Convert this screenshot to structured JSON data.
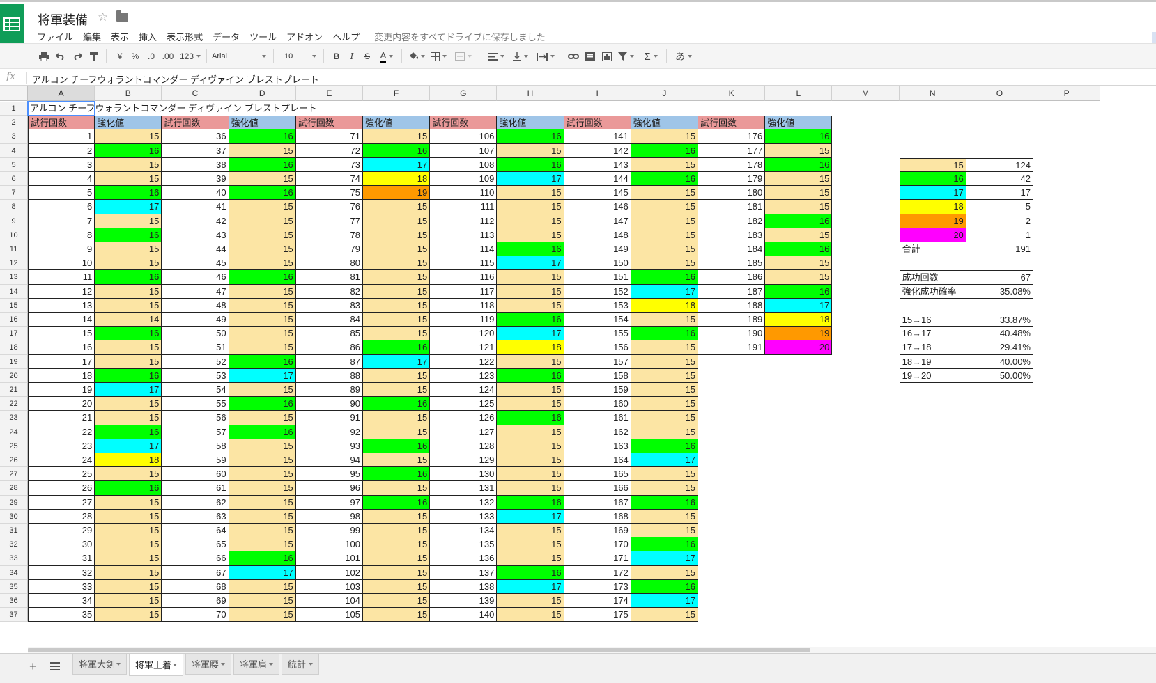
{
  "app": {
    "title": "将軍装備",
    "menu": [
      "ファイル",
      "編集",
      "表示",
      "挿入",
      "表示形式",
      "データ",
      "ツール",
      "アドオン",
      "ヘルプ"
    ],
    "save_status": "変更内容をすべてドライブに保存しました"
  },
  "toolbar": {
    "currency": "¥",
    "percent": "%",
    "dec_less": ".0",
    "dec_more": ".00",
    "format_more": "123",
    "font": "Arial",
    "font_size": "10",
    "bold": "B",
    "italic": "I",
    "strike": "S",
    "text_color": "A",
    "input_tools": "あ"
  },
  "formula": {
    "fx": "fx",
    "value": "アルコン チーフウォラントコマンダー ディヴァイン ブレストプレート"
  },
  "title_cell": "アルコン チーフウォラントコマンダー ディヴァイン ブレストプレート",
  "columns": [
    "A",
    "B",
    "C",
    "D",
    "E",
    "F",
    "G",
    "H",
    "I",
    "J",
    "K",
    "L",
    "M",
    "N",
    "O",
    "P"
  ],
  "row_numbers": [
    1,
    2,
    3,
    4,
    5,
    6,
    7,
    8,
    9,
    10,
    11,
    12,
    13,
    14,
    15,
    16,
    17,
    18,
    19,
    20,
    21,
    22,
    23,
    24,
    25,
    26,
    27,
    28,
    29,
    30,
    31,
    32,
    33,
    34,
    35,
    36,
    37
  ],
  "headers": {
    "trial": "試行回数",
    "value": "強化値"
  },
  "value_colors": {
    "15": "#fce5a4",
    "16": "#00ff00",
    "17": "#00ffff",
    "18": "#ffff00",
    "19": "#ff9900",
    "20": "#ff00ff"
  },
  "header_colors": {
    "trial": "#ea9999",
    "value": "#9fc5e8"
  },
  "trial_blocks": [
    {
      "start": 1,
      "values": [
        15,
        16,
        15,
        15,
        16,
        17,
        15,
        16,
        15,
        15,
        16,
        15,
        15,
        14,
        16,
        15,
        15,
        16,
        17,
        15,
        15,
        16,
        17,
        18,
        15,
        16,
        15,
        15,
        15,
        15,
        15,
        15,
        15,
        15,
        15
      ]
    },
    {
      "start": 36,
      "values": [
        16,
        15,
        16,
        15,
        16,
        15,
        15,
        15,
        15,
        15,
        16,
        15,
        15,
        15,
        15,
        15,
        16,
        17,
        15,
        16,
        15,
        16,
        15,
        15,
        15,
        15,
        15,
        15,
        15,
        15,
        16,
        17,
        15,
        15,
        15
      ]
    },
    {
      "start": 71,
      "values": [
        15,
        16,
        17,
        18,
        19,
        15,
        15,
        15,
        15,
        15,
        15,
        15,
        15,
        15,
        15,
        16,
        17,
        15,
        15,
        16,
        15,
        15,
        16,
        15,
        16,
        15,
        16,
        15,
        15,
        15,
        15,
        15,
        15,
        15,
        15
      ]
    },
    {
      "start": 106,
      "values": [
        16,
        15,
        16,
        17,
        15,
        15,
        15,
        15,
        16,
        17,
        15,
        15,
        15,
        16,
        17,
        18,
        15,
        16,
        15,
        15,
        16,
        15,
        15,
        15,
        15,
        15,
        16,
        17,
        15,
        15,
        15,
        16,
        17,
        15,
        15
      ]
    },
    {
      "start": 141,
      "values": [
        15,
        16,
        15,
        16,
        15,
        15,
        15,
        15,
        15,
        15,
        16,
        17,
        18,
        15,
        16,
        15,
        15,
        15,
        15,
        15,
        15,
        15,
        16,
        17,
        15,
        15,
        16,
        15,
        15,
        16,
        17,
        15,
        16,
        17,
        15
      ]
    },
    {
      "start": 176,
      "values": [
        16,
        15,
        16,
        15,
        15,
        15,
        16,
        15,
        16,
        15,
        15,
        16,
        17,
        18,
        19,
        20
      ]
    }
  ],
  "summary": {
    "counts": [
      {
        "value": 15,
        "count": 124
      },
      {
        "value": 16,
        "count": 42
      },
      {
        "value": 17,
        "count": 17
      },
      {
        "value": 18,
        "count": 5
      },
      {
        "value": 19,
        "count": 2
      },
      {
        "value": 20,
        "count": 1
      }
    ],
    "total_label": "合計",
    "total": 191,
    "success_label": "成功回数",
    "success": 67,
    "rate_label": "強化成功確率",
    "rate": "35.08%",
    "transitions": [
      {
        "label": "15→16",
        "rate": "33.87%"
      },
      {
        "label": "16→17",
        "rate": "40.48%"
      },
      {
        "label": "17→18",
        "rate": "29.41%"
      },
      {
        "label": "18→19",
        "rate": "40.00%"
      },
      {
        "label": "19→20",
        "rate": "50.00%"
      }
    ]
  },
  "sheet_tabs": [
    {
      "name": "将軍大剣",
      "active": false
    },
    {
      "name": "将軍上着",
      "active": true
    },
    {
      "name": "将軍腰",
      "active": false
    },
    {
      "name": "将軍肩",
      "active": false
    },
    {
      "name": "統計",
      "active": false
    }
  ]
}
